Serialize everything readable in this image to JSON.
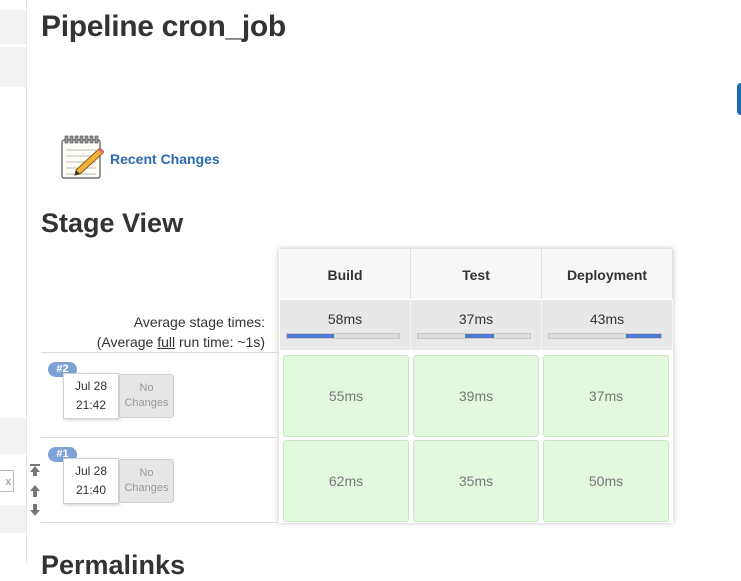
{
  "page": {
    "title": "Pipeline cron_job",
    "recent_changes_label": "Recent Changes",
    "stage_view_title": "Stage View",
    "next_section_title": "Permalinks"
  },
  "stage_view": {
    "avg_label_line1": "Average stage times:",
    "avg_label_prefix": "(Average ",
    "avg_label_full": "full",
    "avg_label_suffix": " run time: ~1s)",
    "stages": [
      {
        "name": "Build",
        "avg": "58ms"
      },
      {
        "name": "Test",
        "avg": "37ms"
      },
      {
        "name": "Deployment",
        "avg": "43ms"
      }
    ],
    "runs": [
      {
        "badge": "#2",
        "date": "Jul 28",
        "time": "21:42",
        "changes": "No Changes",
        "durations": [
          "55ms",
          "39ms",
          "37ms"
        ]
      },
      {
        "badge": "#1",
        "date": "Jul 28",
        "time": "21:40",
        "changes": "No Changes",
        "durations": [
          "62ms",
          "35ms",
          "50ms"
        ]
      }
    ]
  },
  "sidebar": {
    "search_clear": "x"
  },
  "colors": {
    "link": "#2a6bb0",
    "success_cell": "#e2f9de",
    "progress_bar": "#4f7ad4",
    "run_badge": "#7fa2d6"
  }
}
